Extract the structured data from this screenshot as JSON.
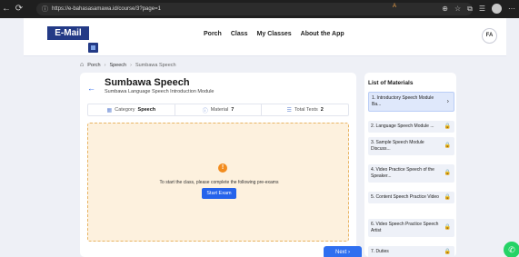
{
  "browser": {
    "url": "https://e-bahasasamawa.id/course/3?page=1"
  },
  "site": {
    "logo": "E-Mail",
    "nav": [
      "Porch",
      "Class",
      "My Classes",
      "About the App"
    ],
    "user_initials": "FA"
  },
  "breadcrumb": [
    "Porch",
    "Speech",
    "Sumbawa Speech"
  ],
  "course": {
    "title": "Sumbawa Speech",
    "subtitle": "Sumbawa Language Speech Introduction Module",
    "info": [
      {
        "label": "Category",
        "value": "Speech",
        "icon": "category-icon"
      },
      {
        "label": "Material",
        "value": "7",
        "icon": "info-icon"
      },
      {
        "label": "Total Tests",
        "value": "2",
        "icon": "list-icon"
      }
    ],
    "exam_message": "To start the class, please complete the following pre-exams",
    "start_button": "Start Exam",
    "next_button": "Next"
  },
  "materials": {
    "title": "List of Materials",
    "items": [
      {
        "label": "1. Introductory Speech Module Ba...",
        "active": true
      },
      {
        "label": "2. Language Speech Module ...",
        "locked": true
      },
      {
        "label": "3. Sample Speech Module Discuss...",
        "locked": true
      },
      {
        "label": "4. Video Practice Speech of the Speaker...",
        "locked": true
      },
      {
        "label": "5. Content Speech Practice Video",
        "locked": true
      },
      {
        "label": "6. Video Speech Practice Speech Artist",
        "locked": true
      },
      {
        "label": "7. Duties",
        "locked": true
      }
    ]
  },
  "colors": {
    "brand": "#233a86",
    "accent": "#2563eb",
    "warning": "#f28c1f",
    "exam_bg": "#fdf1de",
    "whatsapp": "#25d366"
  }
}
